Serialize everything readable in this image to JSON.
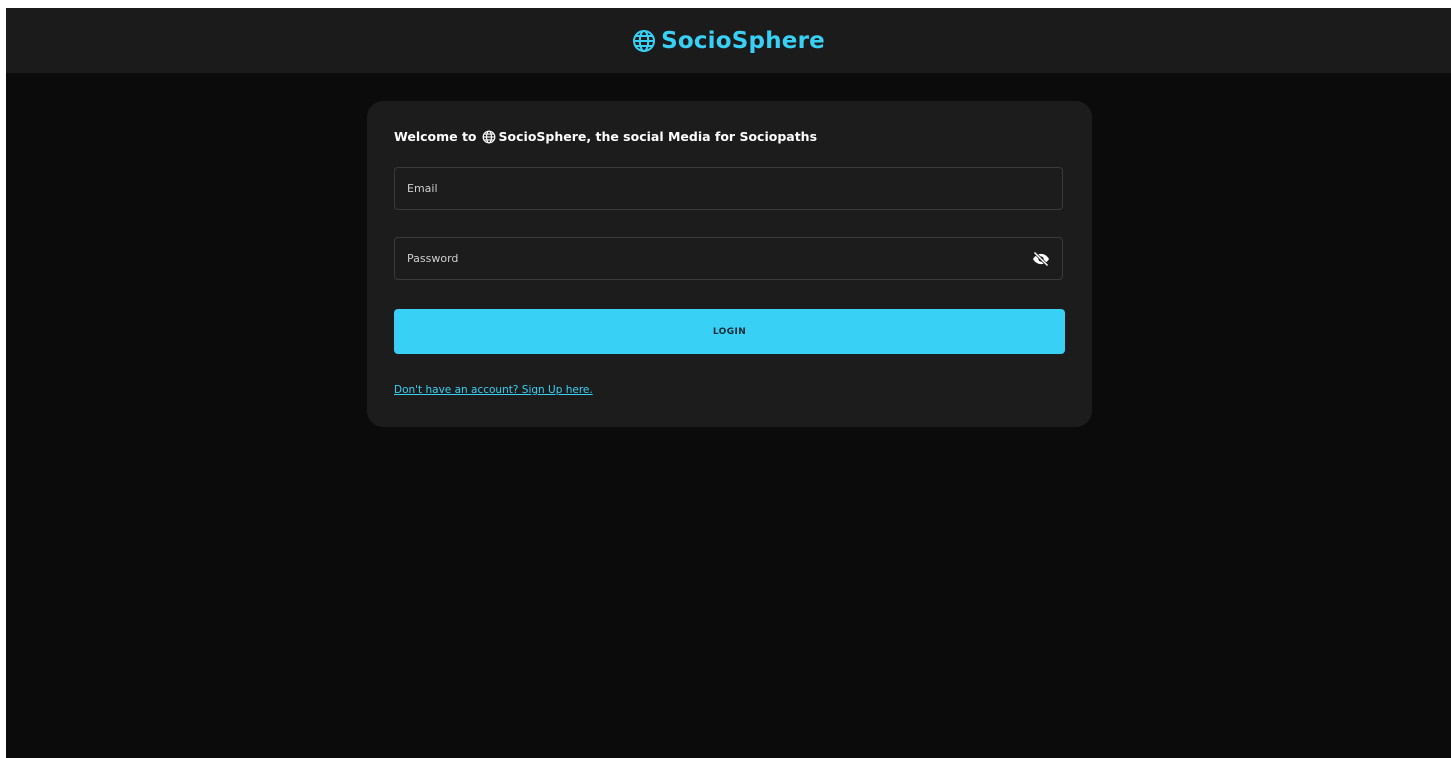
{
  "header": {
    "brand_name": "SocioSphere",
    "brand_icon": "globe-icon",
    "brand_color": "#38d1f5"
  },
  "login_card": {
    "welcome_prefix": "Welcome to",
    "welcome_brand": "SocioSphere, the social Media for Sociopaths",
    "email": {
      "placeholder": "Email",
      "value": ""
    },
    "password": {
      "placeholder": "Password",
      "value": "",
      "toggle_icon": "eye-slash-icon"
    },
    "login_label": "LOGIN",
    "signup_link": "Don't have an account? Sign Up here."
  },
  "colors": {
    "background": "#0b0b0b",
    "topbar": "#1b1b1b",
    "card": "#1c1c1c",
    "accent": "#38d1f5"
  }
}
